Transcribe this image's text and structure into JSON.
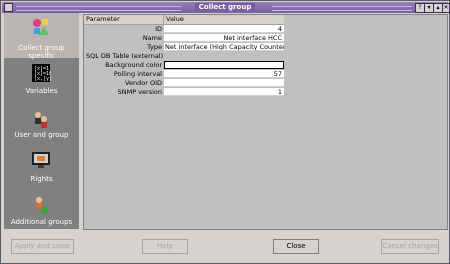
{
  "window": {
    "title": "Collect group",
    "buttons": [
      "?",
      "▾",
      "▴",
      "✕"
    ]
  },
  "sidebar": {
    "items": [
      {
        "label": "Collect group specific",
        "icon": "blocks-icon",
        "active": true
      },
      {
        "label": "Variables",
        "icon": "variables-icon",
        "active": false
      },
      {
        "label": "User and group",
        "icon": "users-icon",
        "active": false
      },
      {
        "label": "Rights",
        "icon": "monitor-icon",
        "active": false
      },
      {
        "label": "Additional groups",
        "icon": "groups-icon",
        "active": false
      }
    ]
  },
  "table": {
    "headers": [
      "Parameter",
      "Value"
    ],
    "rows": [
      {
        "key": "ID",
        "value": "4"
      },
      {
        "key": "Name",
        "value": "Net interface HCC"
      },
      {
        "key": "Type",
        "value": "Net interface (High Capacity Counters)"
      },
      {
        "key": "SQL DB Table (external)",
        "value": ""
      },
      {
        "key": "Background color",
        "value": ""
      },
      {
        "key": "Polling interval",
        "value": "57"
      },
      {
        "key": "Vendor OID",
        "value": ""
      },
      {
        "key": "SNMP version",
        "value": "1"
      }
    ]
  },
  "footer": {
    "apply": "Apply and close",
    "help": "Help",
    "close": "Close",
    "extra": "Cancel changes"
  }
}
